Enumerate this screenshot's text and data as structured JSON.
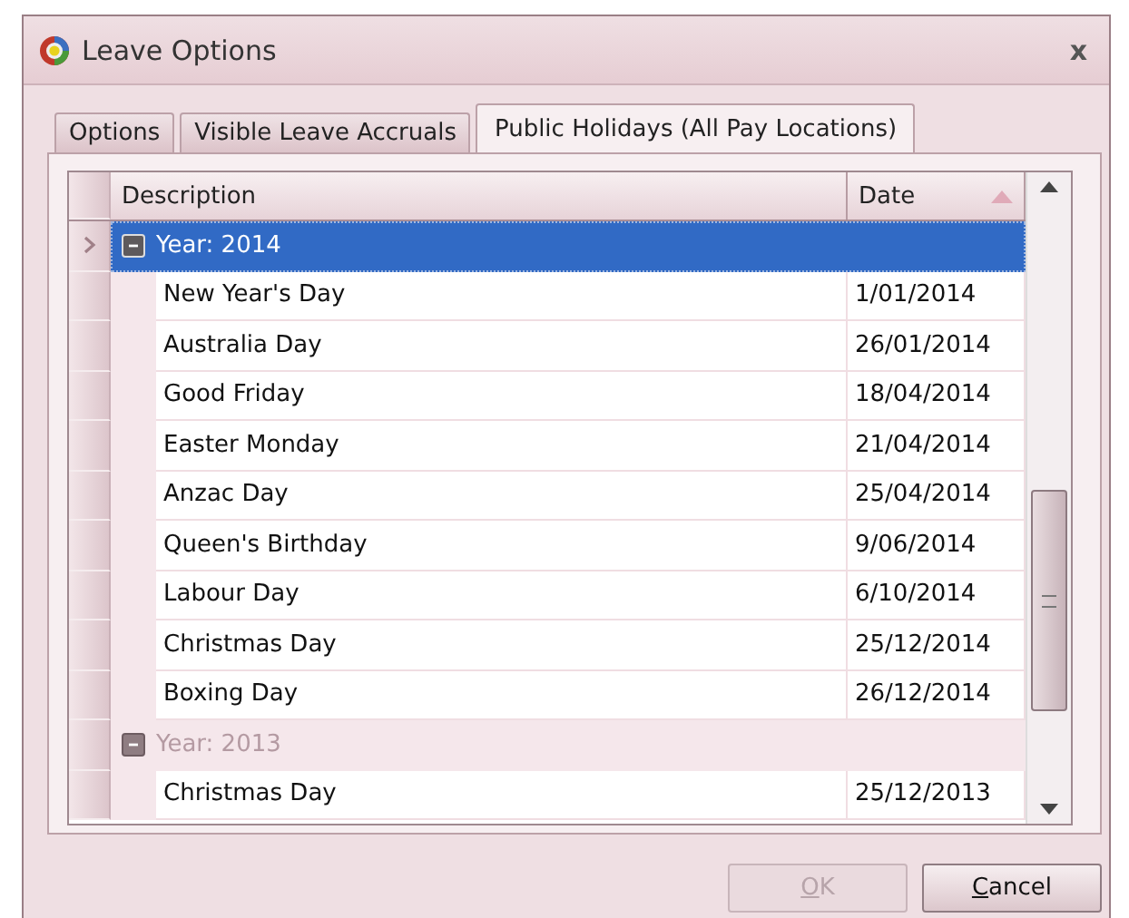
{
  "window": {
    "title": "Leave Options",
    "close": "x"
  },
  "tabs": [
    {
      "label": "Options",
      "selected": false
    },
    {
      "label": "Visible Leave Accruals",
      "selected": false
    },
    {
      "label": "Public Holidays (All Pay Locations)",
      "selected": true
    }
  ],
  "grid": {
    "columns": [
      {
        "label": "Description"
      },
      {
        "label": "Date",
        "sort_ascending": true
      }
    ],
    "groups": [
      {
        "label": "Year: 2014",
        "expanded": true,
        "selected": true,
        "rows": [
          {
            "description": "New Year's Day",
            "date": "1/01/2014"
          },
          {
            "description": "Australia Day",
            "date": "26/01/2014"
          },
          {
            "description": "Good Friday",
            "date": "18/04/2014"
          },
          {
            "description": "Easter Monday",
            "date": "21/04/2014"
          },
          {
            "description": "Anzac Day",
            "date": "25/04/2014"
          },
          {
            "description": "Queen's Birthday",
            "date": "9/06/2014"
          },
          {
            "description": "Labour Day",
            "date": "6/10/2014"
          },
          {
            "description": "Christmas Day",
            "date": "25/12/2014"
          },
          {
            "description": "Boxing Day",
            "date": "26/12/2014"
          }
        ]
      },
      {
        "label": "Year: 2013",
        "expanded": true,
        "selected": false,
        "rows": [
          {
            "description": "Christmas Day",
            "date": "25/12/2013"
          }
        ]
      }
    ]
  },
  "buttons": [
    {
      "label": "OK",
      "disabled": true
    },
    {
      "label": "Cancel",
      "disabled": false
    }
  ]
}
